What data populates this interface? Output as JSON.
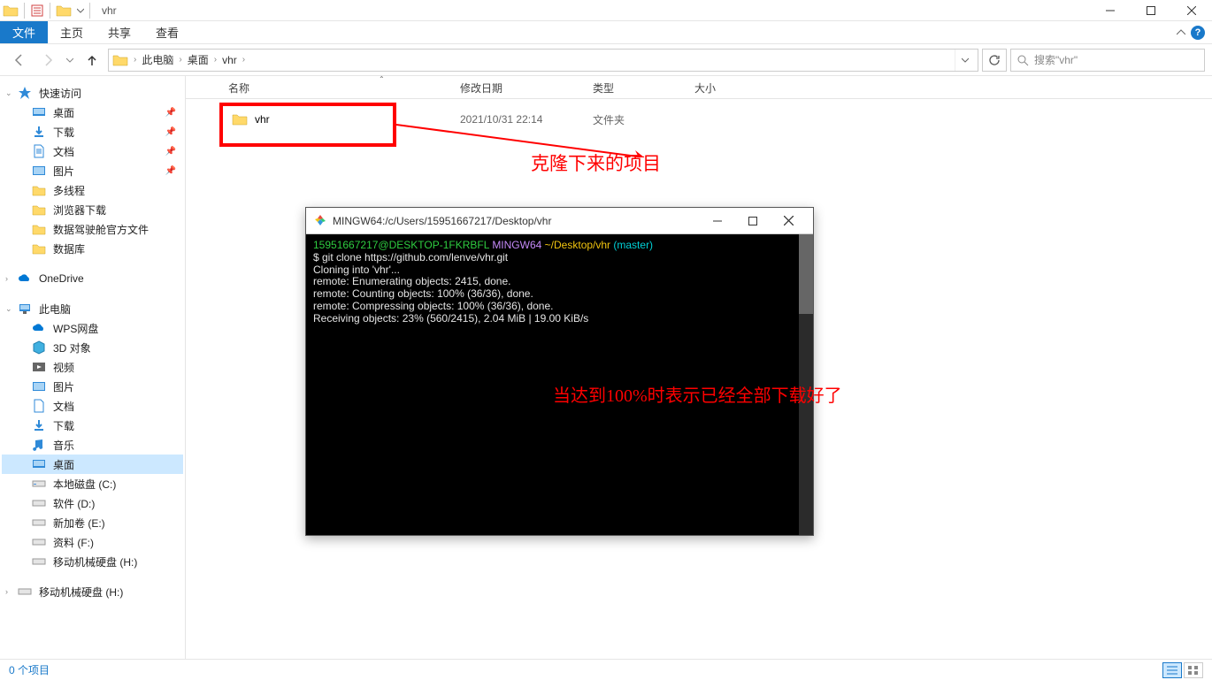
{
  "window": {
    "title": "vhr"
  },
  "ribbon": {
    "file": "文件",
    "home": "主页",
    "share": "共享",
    "view": "查看"
  },
  "breadcrumb": {
    "pc": "此电脑",
    "desktop": "桌面",
    "folder": "vhr"
  },
  "search": {
    "placeholder": "搜索\"vhr\""
  },
  "navpane": {
    "quick": "快速访问",
    "desktop": "桌面",
    "downloads": "下载",
    "documents": "文档",
    "pictures": "图片",
    "multi": "多线程",
    "browser": "浏览器下载",
    "data1": "数据驾驶舱官方文件",
    "db": "数据库",
    "onedrive": "OneDrive",
    "thispc": "此电脑",
    "wps": "WPS网盘",
    "obj3d": "3D 对象",
    "videos": "视频",
    "pictures2": "图片",
    "documents2": "文档",
    "downloads2": "下载",
    "music": "音乐",
    "desktop2": "桌面",
    "diskc": "本地磁盘 (C:)",
    "diskd": "软件 (D:)",
    "diske": "新加卷 (E:)",
    "diskf": "资料 (F:)",
    "diskh1": "移动机械硬盘 (H:)",
    "diskh2": "移动机械硬盘 (H:)"
  },
  "columns": {
    "name": "名称",
    "date": "修改日期",
    "type": "类型",
    "size": "大小"
  },
  "row": {
    "name": "vhr",
    "date": "2021/10/31 22:14",
    "type": "文件夹"
  },
  "annotation1": "克隆下来的项目",
  "annotation2": "当达到100%时表示已经全部下载好了",
  "terminal": {
    "title": "MINGW64:/c/Users/15951667217/Desktop/vhr",
    "prompt_user": "15951667217@DESKTOP-1FKRBFL",
    "prompt_env": "MINGW64",
    "prompt_path": "~/Desktop/vhr",
    "prompt_branch": "(master)",
    "cmd": "$ git clone https://github.com/lenve/vhr.git",
    "l1": "Cloning into 'vhr'...",
    "l2": "remote: Enumerating objects: 2415, done.",
    "l3": "remote: Counting objects: 100% (36/36), done.",
    "l4": "remote: Compressing objects: 100% (36/36), done.",
    "l5": "Receiving objects:  23% (560/2415), 2.04 MiB | 19.00 KiB/s"
  },
  "status": "0 个项目"
}
